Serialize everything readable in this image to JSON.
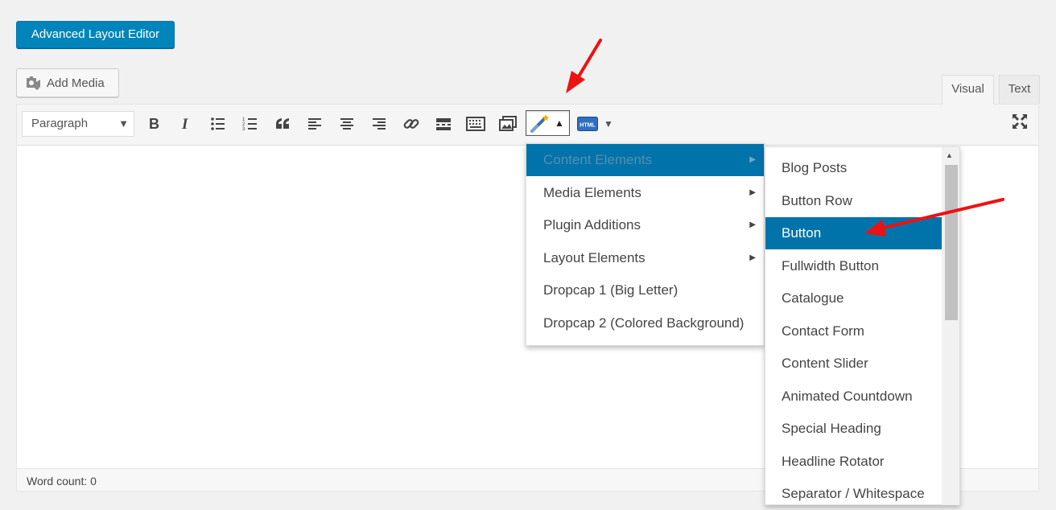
{
  "top_button": {
    "label": "Advanced Layout Editor"
  },
  "add_media": {
    "label": "Add Media",
    "icon": "media-icon"
  },
  "tabs": [
    {
      "label": "Visual",
      "active": true
    },
    {
      "label": "Text",
      "active": false
    }
  ],
  "toolbar": {
    "format_select": {
      "value": "Paragraph"
    },
    "buttons": [
      "bold-icon",
      "italic-icon",
      "bullet-list-icon",
      "numbered-list-icon",
      "blockquote-icon",
      "align-left-icon",
      "align-center-icon",
      "align-right-icon",
      "link-icon",
      "horizontal-line-icon",
      "keyboard-icon",
      "gallery-icon",
      "magic-wand-icon",
      "html-icon",
      "fullscreen-icon"
    ]
  },
  "menu_primary": {
    "items": [
      {
        "label": "Content Elements",
        "has_submenu": true,
        "active": true
      },
      {
        "label": "Media Elements",
        "has_submenu": true
      },
      {
        "label": "Plugin Additions",
        "has_submenu": true
      },
      {
        "label": "Layout Elements",
        "has_submenu": true
      },
      {
        "label": "Dropcap 1 (Big Letter)",
        "has_submenu": false
      },
      {
        "label": "Dropcap 2 (Colored Background)",
        "has_submenu": false
      }
    ]
  },
  "menu_secondary": {
    "items": [
      {
        "label": "Blog Posts"
      },
      {
        "label": "Button Row"
      },
      {
        "label": "Button",
        "active": true
      },
      {
        "label": "Fullwidth Button"
      },
      {
        "label": "Catalogue"
      },
      {
        "label": "Contact Form"
      },
      {
        "label": "Content Slider"
      },
      {
        "label": "Animated Countdown"
      },
      {
        "label": "Special Heading"
      },
      {
        "label": "Headline Rotator"
      },
      {
        "label": "Separator / Whitespace"
      }
    ]
  },
  "status_bar": {
    "word_count": "Word count: 0"
  },
  "colors": {
    "primary": "#0085ba",
    "menu_active": "#0073aa",
    "annotation_arrow": "#ee1111"
  }
}
